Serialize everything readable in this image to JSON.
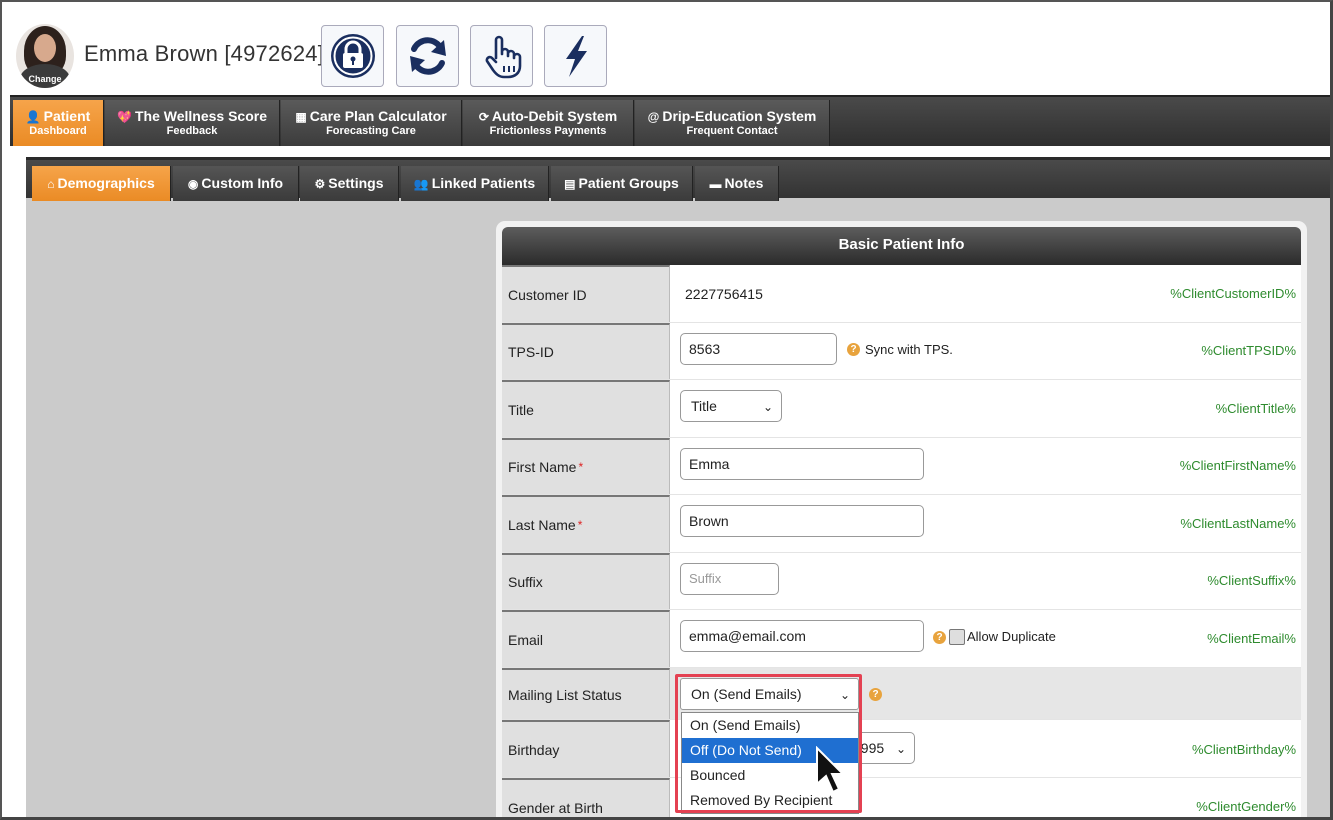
{
  "header": {
    "patient_name": "Emma Brown [4972624]",
    "avatar_label": "Change",
    "buttons": [
      {
        "icon": "lock-icon"
      },
      {
        "icon": "refresh-icon"
      },
      {
        "icon": "pointer-hand-icon"
      },
      {
        "icon": "lightning-icon"
      }
    ]
  },
  "main_nav": [
    {
      "label": "Patient",
      "sub": "Dashboard",
      "icon": "👤",
      "active": true
    },
    {
      "label": "The Wellness Score",
      "sub": "Feedback",
      "icon": "💖"
    },
    {
      "label": "Care Plan Calculator",
      "sub": "Forecasting Care",
      "icon": "▦"
    },
    {
      "label": "Auto-Debit System",
      "sub": "Frictionless Payments",
      "icon": "⟳"
    },
    {
      "label": "Drip-Education System",
      "sub": "Frequent Contact",
      "icon": "@"
    }
  ],
  "sub_tabs": [
    {
      "label": "Demographics",
      "icon": "⌂",
      "active": true
    },
    {
      "label": "Custom Info",
      "icon": "◉"
    },
    {
      "label": "Settings",
      "icon": "⚙"
    },
    {
      "label": "Linked Patients",
      "icon": "👥"
    },
    {
      "label": "Patient Groups",
      "icon": "▤"
    },
    {
      "label": "Notes",
      "icon": "▬"
    }
  ],
  "panel": {
    "title": "Basic Patient Info",
    "fields": {
      "customer_id": {
        "label": "Customer ID",
        "value": "2227756415",
        "var": "%ClientCustomerID%"
      },
      "tps_id": {
        "label": "TPS-ID",
        "value": "8563",
        "note": "Sync with TPS.",
        "var": "%ClientTPSID%"
      },
      "title": {
        "label": "Title",
        "value": "Title",
        "var": "%ClientTitle%"
      },
      "first_name": {
        "label": "First Name",
        "value": "Emma",
        "var": "%ClientFirstName%"
      },
      "last_name": {
        "label": "Last Name",
        "value": "Brown",
        "var": "%ClientLastName%"
      },
      "suffix": {
        "label": "Suffix",
        "placeholder": "Suffix",
        "var": "%ClientSuffix%"
      },
      "email": {
        "label": "Email",
        "value": "emma@email.com",
        "note": "Allow Duplicate",
        "var": "%ClientEmail%"
      },
      "mailing": {
        "label": "Mailing List Status",
        "value": "On (Send Emails)"
      },
      "birthday": {
        "label": "Birthday",
        "value": "1995",
        "var": "%ClientBirthday%"
      },
      "gender": {
        "label": "Gender at Birth",
        "var": "%ClientGender%"
      }
    },
    "required_mark": "*"
  },
  "mailing_dropdown": {
    "options": [
      "On (Send Emails)",
      "Off (Do Not Send)",
      "Bounced",
      "Removed By Recipient"
    ],
    "highlighted_index": 1
  },
  "colors": {
    "accent": "#ea8b25",
    "var_text": "#2e8b2e",
    "highlight_box": "#e44152",
    "selected_option": "#1f6fd1"
  }
}
